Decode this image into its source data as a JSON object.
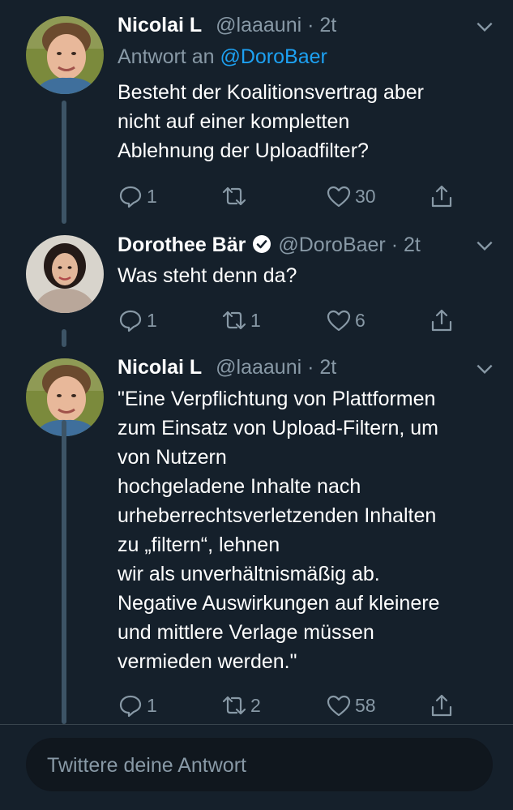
{
  "tweets": [
    {
      "name": "Nicolai L",
      "handle": "@laaauni",
      "time": "· 2t",
      "reply_prefix": "Antwort an",
      "reply_to": "@DoroBaer",
      "text": "Besteht der Koalitionsvertrag aber\nnicht auf einer kompletten\nAblehnung der Uploadfilter?",
      "replies": "1",
      "retweets": "",
      "likes": "30",
      "verified": false
    },
    {
      "name": "Dorothee Bär",
      "handle": "@DoroBaer",
      "time": "· 2t",
      "text": "Was steht denn da?",
      "replies": "1",
      "retweets": "1",
      "likes": "6",
      "verified": true
    },
    {
      "name": "Nicolai L",
      "handle": "@laaauni",
      "time": "· 2t",
      "text": "\"Eine Verpflichtung von Plattformen\nzum Einsatz von Upload-Filtern, um\nvon Nutzern\nhochgeladene Inhalte nach\nurheberrechtsverletzenden Inhalten\nzu „filtern“, lehnen\nwir als unverhältnismäßig ab.\nNegative Auswirkungen auf kleinere\nund mittlere Verlage müssen\nvermieden werden.\"",
      "replies": "1",
      "retweets": "2",
      "likes": "58",
      "verified": false
    }
  ],
  "reply_box": {
    "placeholder": "Twittere deine Antwort"
  },
  "colors": {
    "background": "#15202b",
    "secondary_text": "#8899a6",
    "link": "#1da1f2",
    "thread_line": "#3d5466"
  }
}
